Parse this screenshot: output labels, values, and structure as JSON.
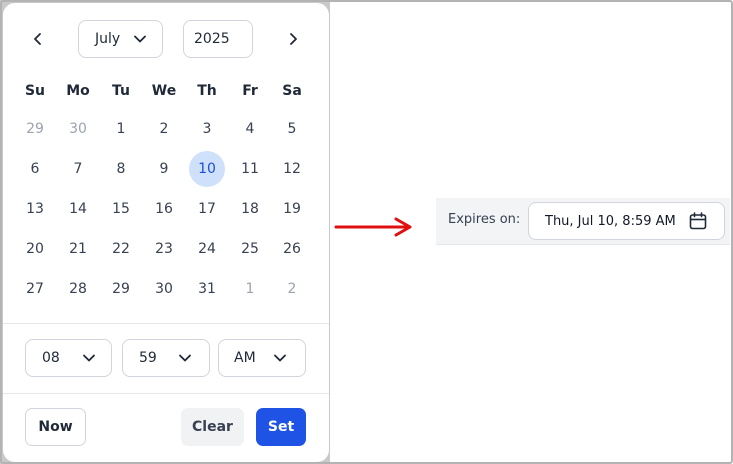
{
  "calendar": {
    "prev_icon": "chevron-left-icon",
    "next_icon": "chevron-right-icon",
    "month": "July",
    "year": "2025",
    "weekdays": [
      "Su",
      "Mo",
      "Tu",
      "We",
      "Th",
      "Fr",
      "Sa"
    ],
    "weeks": [
      [
        "29",
        "30",
        "1",
        "2",
        "3",
        "4",
        "5"
      ],
      [
        "6",
        "7",
        "8",
        "9",
        "10",
        "11",
        "12"
      ],
      [
        "13",
        "14",
        "15",
        "16",
        "17",
        "18",
        "19"
      ],
      [
        "20",
        "21",
        "22",
        "23",
        "24",
        "25",
        "26"
      ],
      [
        "27",
        "28",
        "29",
        "30",
        "31",
        "1",
        "2"
      ]
    ],
    "selected_day": "10"
  },
  "time": {
    "hour": "08",
    "minute": "59",
    "period": "AM"
  },
  "actions": {
    "now_label": "Now",
    "clear_label": "Clear",
    "set_label": "Set"
  },
  "expires": {
    "label": "Expires on:",
    "value": "Thu, Jul 10, 8:59 AM",
    "icon": "calendar-icon"
  },
  "colors": {
    "accent": "#1e53e5",
    "selected_bg": "#cfe0fb",
    "arrow": "#e01010"
  }
}
